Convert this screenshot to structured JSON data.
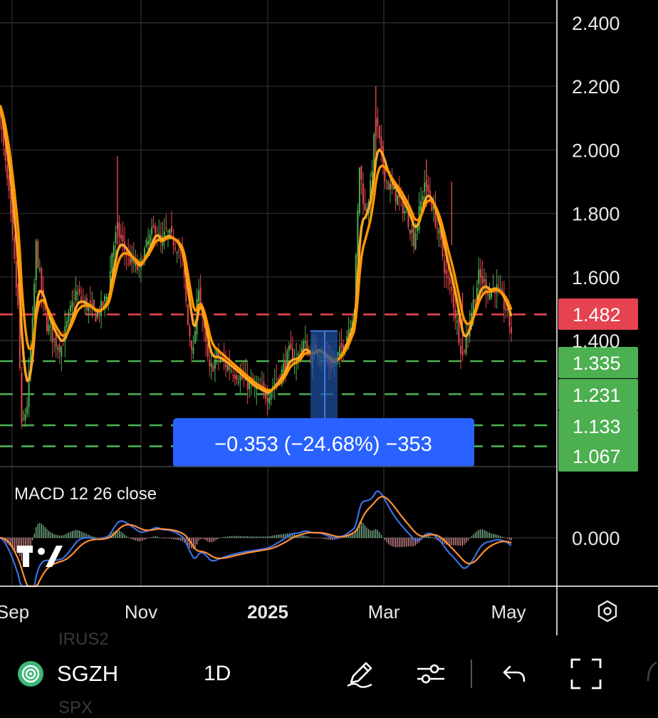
{
  "chart_data": {
    "type": "candlestick",
    "price_axis": {
      "ticks": [
        "2.400",
        "2.200",
        "2.000",
        "1.800",
        "1.600",
        "1.400"
      ],
      "tick_values": [
        2.4,
        2.2,
        2.0,
        1.8,
        1.6,
        1.4
      ],
      "range": [
        1.045,
        2.42
      ]
    },
    "time_axis": {
      "labels": [
        "Sep",
        "Nov",
        "2025",
        "Mar",
        "May"
      ]
    },
    "levels": [
      {
        "label": "1.482",
        "value": 1.482,
        "color": "#e5434f",
        "style": "dashed"
      },
      {
        "label": "1.335",
        "value": 1.335,
        "color": "#4caf50",
        "style": "dashed"
      },
      {
        "label": "1.231",
        "value": 1.231,
        "color": "#4caf50",
        "style": "dashed"
      },
      {
        "label": "1.133",
        "value": 1.133,
        "color": "#4caf50",
        "style": "dashed"
      },
      {
        "label": "1.067",
        "value": 1.067,
        "color": "#4caf50",
        "style": "dashed"
      }
    ],
    "close_series": [
      {
        "d": 0,
        "c": 2.1
      },
      {
        "d": 5,
        "c": 1.85
      },
      {
        "d": 10,
        "c": 1.5
      },
      {
        "d": 12,
        "c": 1.12
      },
      {
        "d": 15,
        "c": 1.2
      },
      {
        "d": 18,
        "c": 1.45
      },
      {
        "d": 20,
        "c": 1.7
      },
      {
        "d": 23,
        "c": 1.55
      },
      {
        "d": 26,
        "c": 1.45
      },
      {
        "d": 30,
        "c": 1.4
      },
      {
        "d": 34,
        "c": 1.38
      },
      {
        "d": 38,
        "c": 1.47
      },
      {
        "d": 42,
        "c": 1.55
      },
      {
        "d": 46,
        "c": 1.52
      },
      {
        "d": 50,
        "c": 1.5
      },
      {
        "d": 53,
        "c": 1.48
      },
      {
        "d": 56,
        "c": 1.5
      },
      {
        "d": 60,
        "c": 1.55
      },
      {
        "d": 62,
        "c": 1.68
      },
      {
        "d": 65,
        "c": 1.75
      },
      {
        "d": 68,
        "c": 1.7
      },
      {
        "d": 71,
        "c": 1.66
      },
      {
        "d": 74,
        "c": 1.64
      },
      {
        "d": 77,
        "c": 1.62
      },
      {
        "d": 80,
        "c": 1.68
      },
      {
        "d": 83,
        "c": 1.72
      },
      {
        "d": 86,
        "c": 1.76
      },
      {
        "d": 89,
        "c": 1.7
      },
      {
        "d": 92,
        "c": 1.74
      },
      {
        "d": 95,
        "c": 1.72
      },
      {
        "d": 98,
        "c": 1.7
      },
      {
        "d": 101,
        "c": 1.65
      },
      {
        "d": 104,
        "c": 1.45
      },
      {
        "d": 107,
        "c": 1.36
      },
      {
        "d": 110,
        "c": 1.58
      },
      {
        "d": 113,
        "c": 1.42
      },
      {
        "d": 116,
        "c": 1.3
      },
      {
        "d": 120,
        "c": 1.35
      },
      {
        "d": 124,
        "c": 1.33
      },
      {
        "d": 128,
        "c": 1.31
      },
      {
        "d": 132,
        "c": 1.29
      },
      {
        "d": 136,
        "c": 1.27
      },
      {
        "d": 140,
        "c": 1.25
      },
      {
        "d": 144,
        "c": 1.24
      },
      {
        "d": 148,
        "c": 1.23
      },
      {
        "d": 152,
        "c": 1.27
      },
      {
        "d": 156,
        "c": 1.3
      },
      {
        "d": 160,
        "c": 1.36
      },
      {
        "d": 164,
        "c": 1.34
      },
      {
        "d": 168,
        "c": 1.39
      },
      {
        "d": 172,
        "c": 1.35
      },
      {
        "d": 176,
        "c": 1.38
      },
      {
        "d": 180,
        "c": 1.34
      },
      {
        "d": 184,
        "c": 1.32
      },
      {
        "d": 188,
        "c": 1.36
      },
      {
        "d": 192,
        "c": 1.42
      },
      {
        "d": 196,
        "c": 1.5
      },
      {
        "d": 199,
        "c": 1.95
      },
      {
        "d": 202,
        "c": 1.8
      },
      {
        "d": 205,
        "c": 1.88
      },
      {
        "d": 208,
        "c": 2.1
      },
      {
        "d": 211,
        "c": 1.98
      },
      {
        "d": 214,
        "c": 1.9
      },
      {
        "d": 217,
        "c": 1.87
      },
      {
        "d": 220,
        "c": 1.85
      },
      {
        "d": 223,
        "c": 1.82
      },
      {
        "d": 226,
        "c": 1.78
      },
      {
        "d": 229,
        "c": 1.72
      },
      {
        "d": 232,
        "c": 1.8
      },
      {
        "d": 235,
        "c": 1.9
      },
      {
        "d": 238,
        "c": 1.85
      },
      {
        "d": 241,
        "c": 1.78
      },
      {
        "d": 244,
        "c": 1.7
      },
      {
        "d": 247,
        "c": 1.6
      },
      {
        "d": 250,
        "c": 1.55
      },
      {
        "d": 253,
        "c": 1.45
      },
      {
        "d": 256,
        "c": 1.35
      },
      {
        "d": 259,
        "c": 1.44
      },
      {
        "d": 262,
        "c": 1.52
      },
      {
        "d": 265,
        "c": 1.6
      },
      {
        "d": 268,
        "c": 1.58
      },
      {
        "d": 271,
        "c": 1.55
      },
      {
        "d": 274,
        "c": 1.57
      },
      {
        "d": 277,
        "c": 1.54
      },
      {
        "d": 280,
        "c": 1.5
      },
      {
        "d": 283,
        "c": 1.43
      }
    ],
    "measure": {
      "text": "−0.353 (−24.68%) −353",
      "from": 1.43,
      "to": 1.077
    },
    "macd": {
      "title": "MACD 12 26 close",
      "axis_tick": "0.000",
      "range": [
        -0.145,
        0.205
      ]
    }
  },
  "toolbar": {
    "symbol": "SGZH",
    "interval": "1D",
    "ghost_above": "IRUS2",
    "ghost_below": "SPX"
  },
  "icons": {
    "settings": "hexagon-settings-icon",
    "symbol_logo": "green-swirl-logo-icon",
    "draw": "pencil-icon",
    "indicators": "sliders-icon",
    "undo": "undo-arrow-icon",
    "fullscreen": "fullscreen-icon",
    "watermark": "tradingview-logo-icon"
  }
}
